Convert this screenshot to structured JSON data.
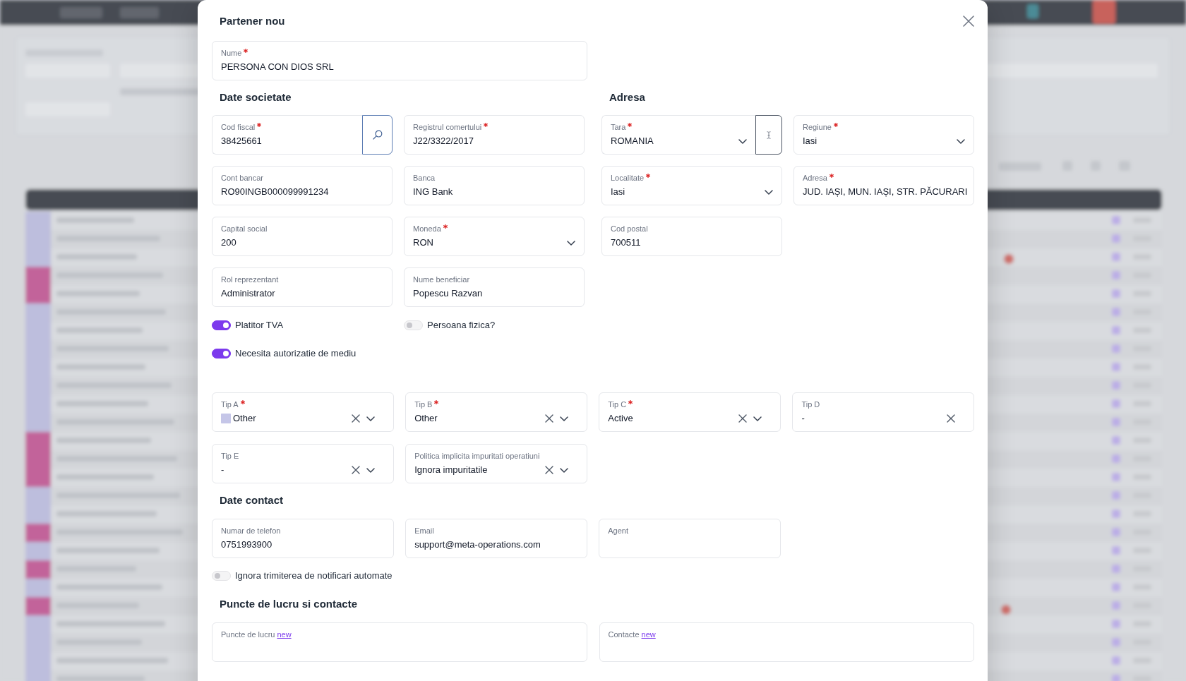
{
  "dialog": {
    "title": "Partener nou"
  },
  "name_field": {
    "label": "Nume",
    "required": true,
    "kind": "text",
    "value": "PERSONA CON DIOS SRL"
  },
  "company": {
    "heading": "Date societate",
    "fields": [
      {
        "label": "Cod fiscal",
        "required": true,
        "kind": "search",
        "value": "38425661"
      },
      {
        "label": "Registrul comertului",
        "required": true,
        "kind": "text",
        "value": "J22/3322/2017"
      },
      {
        "label": "Cont bancar",
        "required": false,
        "kind": "text",
        "value": "RO90INGB000099991234"
      },
      {
        "label": "Banca",
        "required": false,
        "kind": "text",
        "value": "ING Bank"
      },
      {
        "label": "Capital social",
        "required": false,
        "kind": "text",
        "value": "200"
      },
      {
        "label": "Moneda",
        "required": true,
        "kind": "select",
        "value": "RON"
      },
      {
        "label": "Rol reprezentant",
        "required": false,
        "kind": "text",
        "value": "Administrator"
      },
      {
        "label": "Nume beneficiar",
        "required": false,
        "kind": "text",
        "value": "Popescu Razvan"
      }
    ]
  },
  "address": {
    "heading": "Adresa",
    "fields": [
      {
        "label": "Tara",
        "required": true,
        "kind": "select_button",
        "value": "ROMANIA"
      },
      {
        "label": "Regiune",
        "required": true,
        "kind": "select",
        "value": "Iasi"
      },
      {
        "label": "Localitate",
        "required": true,
        "kind": "select",
        "value": "Iasi"
      },
      {
        "label": "Adresa",
        "required": true,
        "kind": "text",
        "value": "JUD. IAȘI, MUN. IAȘI, STR. PĂCURARI"
      },
      {
        "label": "Cod postal",
        "required": false,
        "kind": "text",
        "value": "700511"
      }
    ]
  },
  "company_toggles": [
    {
      "label": "Platitor TVA",
      "on": true
    },
    {
      "label": "Persoana fizica?",
      "on": false
    },
    {
      "label": "Necesita autorizatie de mediu",
      "on": true
    }
  ],
  "types": {
    "fields": [
      {
        "label": "Tip A",
        "required": true,
        "kind": "clear_select",
        "value": "Other",
        "color": "#c5c6e8"
      },
      {
        "label": "Tip B",
        "required": true,
        "kind": "clear_select",
        "value": "Other"
      },
      {
        "label": "Tip C",
        "required": true,
        "kind": "clear_select",
        "value": "Active"
      },
      {
        "label": "Tip D",
        "required": false,
        "kind": "clear",
        "value": "-"
      },
      {
        "label": "Tip E",
        "required": false,
        "kind": "clear_select",
        "value": "-"
      },
      {
        "label": "Politica implicita impuritati operatiuni",
        "required": false,
        "kind": "clear_select",
        "value": "Ignora impuritatile"
      }
    ]
  },
  "contact": {
    "heading": "Date contact",
    "fields": [
      {
        "label": "Numar de telefon",
        "required": false,
        "kind": "text",
        "value": "0751993900"
      },
      {
        "label": "Email",
        "required": false,
        "kind": "text",
        "value": "support@meta-operations.com"
      },
      {
        "label": "Agent",
        "required": false,
        "kind": "text"
      }
    ],
    "toggles": [
      {
        "label": "Ignora trimiterea de notificari automate",
        "on": false
      }
    ]
  },
  "work_points": {
    "heading": "Puncte de lucru si contacte",
    "fields": [
      {
        "label": "Puncte de lucru",
        "kind": "text",
        "link": "new"
      },
      {
        "label": "Contacte",
        "kind": "text",
        "link": "new"
      }
    ]
  }
}
